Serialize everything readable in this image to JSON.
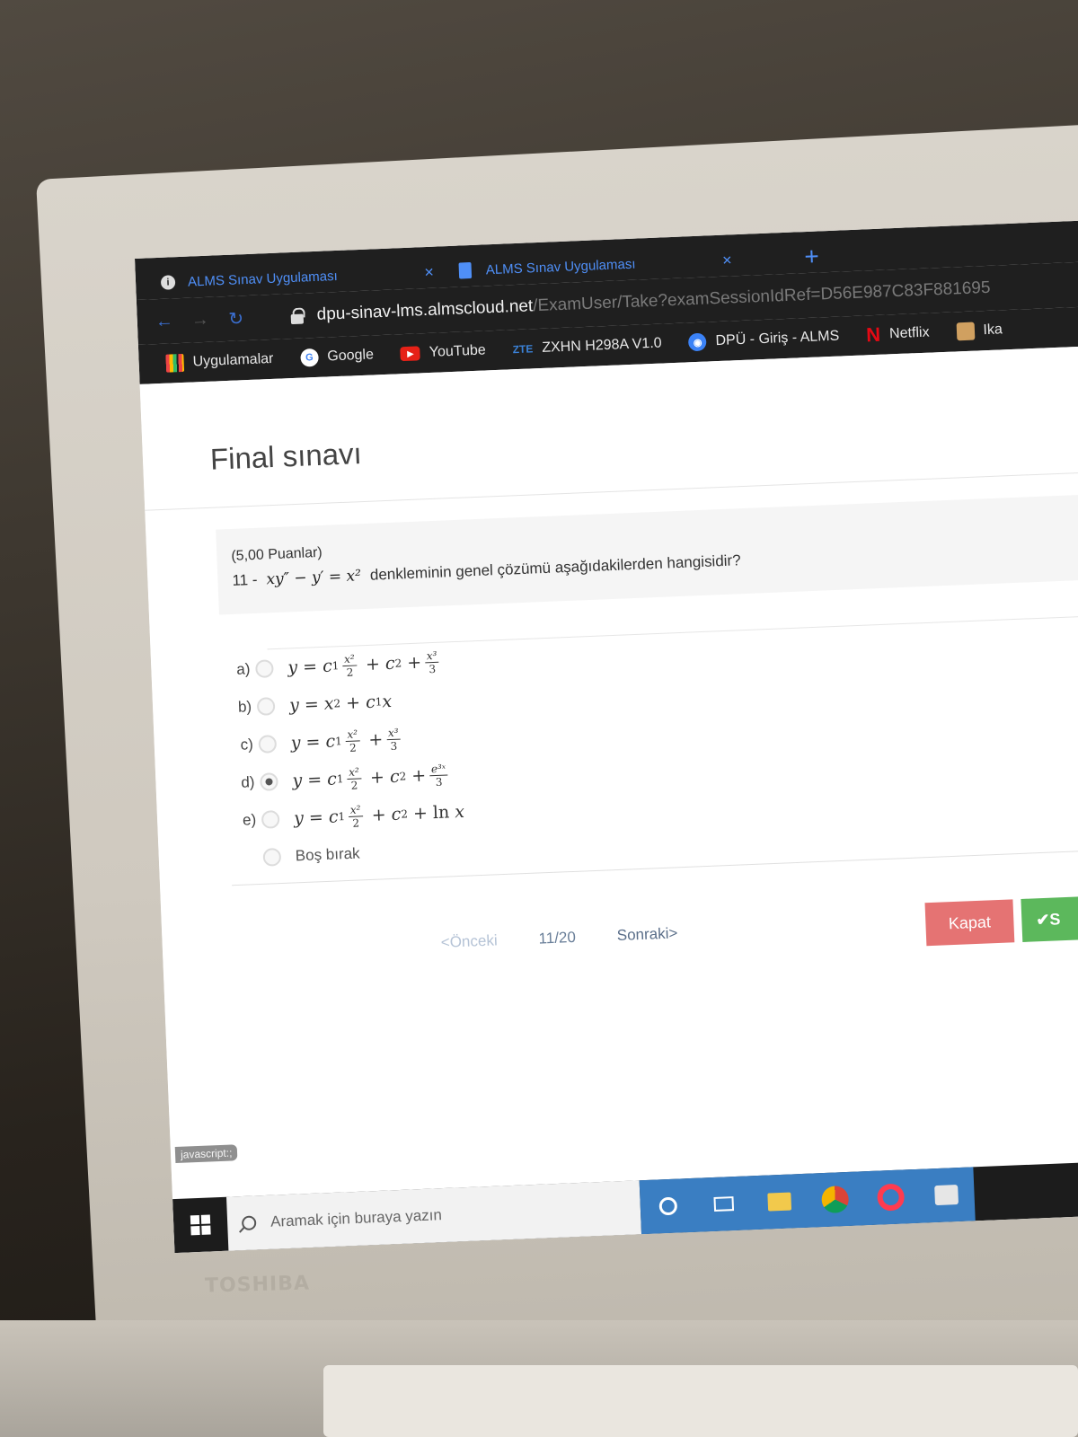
{
  "browser": {
    "tabs": [
      {
        "title": "ALMS Sınav Uygulaması",
        "close": "×"
      },
      {
        "title": "ALMS Sınav Uygulaması",
        "close": "×"
      }
    ],
    "new_tab": "+",
    "url_host": "dpu-sinav-lms.almscloud.net",
    "url_path": "/ExamUser/Take?examSessionIdRef=D56E987C83F881695",
    "bookmarks": [
      {
        "label": "Uygulamalar",
        "icon": "apps-icon"
      },
      {
        "label": "Google",
        "icon": "google-icon",
        "glyph": "G"
      },
      {
        "label": "YouTube",
        "icon": "youtube-icon",
        "glyph": "▶"
      },
      {
        "label": "ZXHN H298A V1.0",
        "icon": "zte-icon",
        "glyph": "ZTE"
      },
      {
        "label": "DPÜ - Giriş - ALMS",
        "icon": "globe-icon",
        "glyph": "◉"
      },
      {
        "label": "Netflix",
        "icon": "netflix-icon",
        "glyph": "N"
      },
      {
        "label": "Ika",
        "icon": "avatar-icon"
      }
    ]
  },
  "exam": {
    "title": "Final sınavı",
    "points": "(5,00 Puanlar)",
    "question_number": "11 -",
    "question_math": "xy″ − y′ = x²",
    "question_text": "denkleminin genel çözümü aşağıdakilerden hangisidir?",
    "options": [
      {
        "letter": "a)",
        "selected": false
      },
      {
        "letter": "b)",
        "selected": false
      },
      {
        "letter": "c)",
        "selected": false
      },
      {
        "letter": "d)",
        "selected": true
      },
      {
        "letter": "e)",
        "selected": false
      }
    ],
    "skip_label": "Boş bırak"
  },
  "pager": {
    "prev": "<Önceki",
    "position": "11/20",
    "next": "Sonraki>"
  },
  "actions": {
    "close": "Kapat",
    "save": "✔S"
  },
  "status": "javascript:;",
  "taskbar": {
    "search_placeholder": "Aramak için buraya yazın"
  },
  "device_brand": "TOSHIBA"
}
